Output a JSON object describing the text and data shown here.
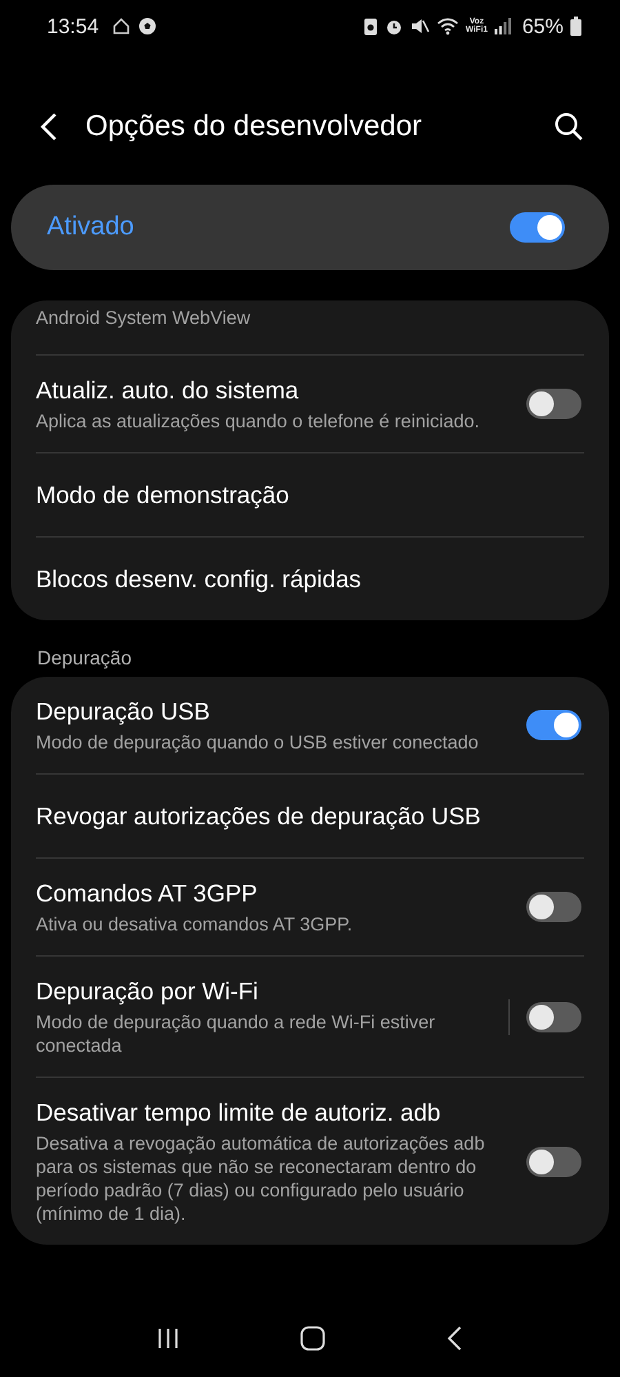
{
  "status_bar": {
    "time": "13:54",
    "network_label_top": "Voz",
    "network_label_bottom": "WiFi1",
    "battery": "65%"
  },
  "header": {
    "title": "Opções do desenvolvedor"
  },
  "master": {
    "label": "Ativado",
    "on": true
  },
  "groups": [
    {
      "items": [
        {
          "kind": "clipped",
          "subtitle": "Android System WebView"
        },
        {
          "kind": "toggle",
          "title": "Atualiz. auto. do sistema",
          "subtitle": "Aplica as atualizações quando o telefone é reiniciado.",
          "on": false
        },
        {
          "kind": "plain",
          "title": "Modo de demonstração"
        },
        {
          "kind": "plain",
          "title": "Blocos desenv. config. rápidas"
        }
      ]
    },
    {
      "heading": "Depuração",
      "items": [
        {
          "kind": "toggle",
          "title": "Depuração USB",
          "subtitle": "Modo de depuração quando o USB estiver conectado",
          "on": true
        },
        {
          "kind": "plain",
          "title": "Revogar autorizações de depuração USB"
        },
        {
          "kind": "toggle",
          "title": "Comandos AT 3GPP",
          "subtitle": "Ativa ou desativa comandos AT 3GPP.",
          "on": false
        },
        {
          "kind": "split",
          "title": "Depuração por Wi-Fi",
          "subtitle": "Modo de depuração quando a rede Wi-Fi estiver conectada",
          "on": false
        },
        {
          "kind": "toggle",
          "title": "Desativar tempo limite de autoriz. adb",
          "subtitle": "Desativa a revogação automática de autorizações adb para os sistemas que não se reconectaram dentro do período padrão (7 dias) ou configurado pelo usuário (mínimo de 1 dia).",
          "on": false
        }
      ]
    }
  ]
}
